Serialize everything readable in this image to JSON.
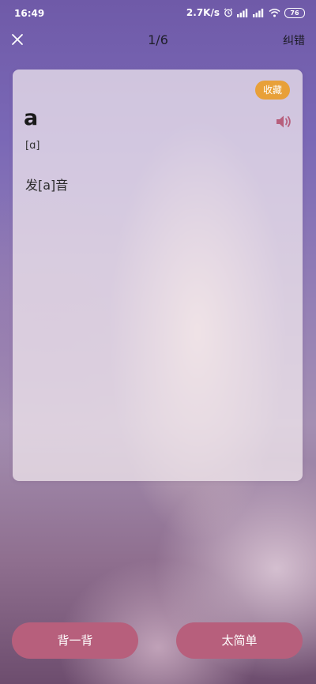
{
  "status_bar": {
    "time": "16:49",
    "network_speed": "2.7K/s",
    "battery_level": "76",
    "icons": [
      "alarm-icon",
      "signal-icon",
      "signal-icon",
      "wifi-icon",
      "battery-icon"
    ]
  },
  "header": {
    "close_icon": "close-icon",
    "progress": "1/6",
    "report_label": "纠错"
  },
  "card": {
    "favorite_label": "收藏",
    "word": "a",
    "phonetic": "[ɑ]",
    "description": "发[a]音",
    "speaker_icon": "speaker-icon"
  },
  "actions": {
    "memorize_label": "背一背",
    "too_easy_label": "太简单"
  },
  "colors": {
    "favorite_badge": "#e8a039",
    "action_button": "#b75f7c",
    "speaker": "#b75f7c"
  }
}
